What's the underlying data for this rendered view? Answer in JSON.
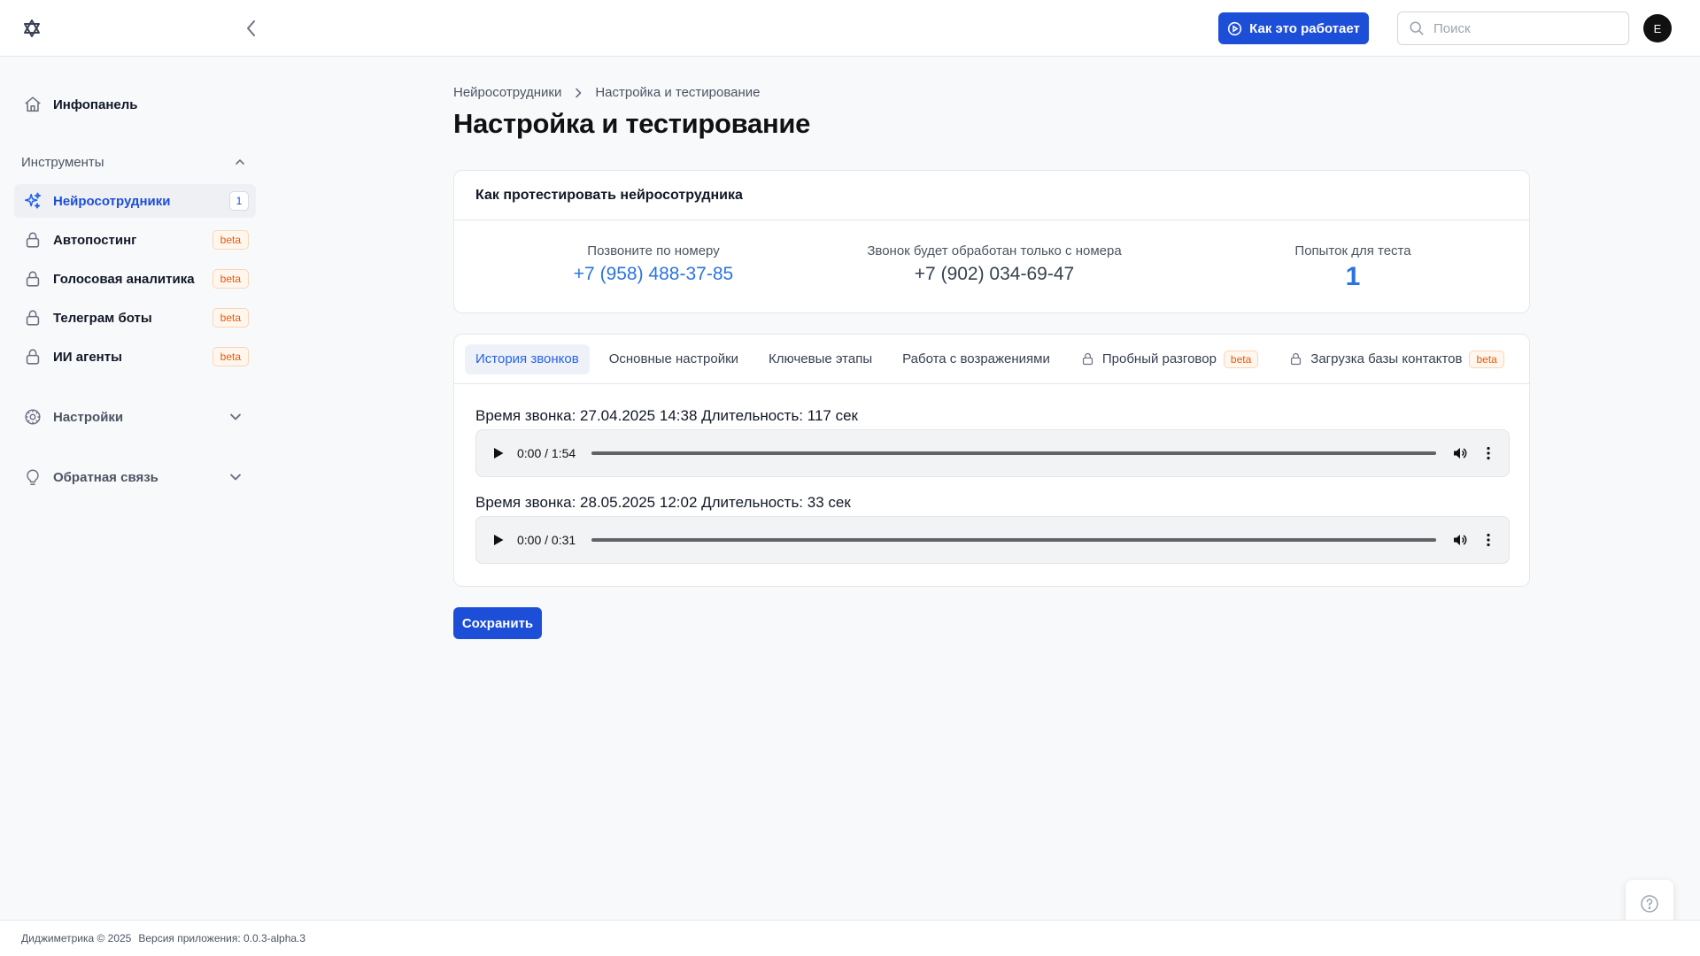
{
  "header": {
    "how_it_works_label": "Как это работает",
    "search_placeholder": "Поиск",
    "avatar_initial": "E"
  },
  "sidebar": {
    "dashboard_label": "Инфопанель",
    "tools_section": "Инструменты",
    "items": [
      {
        "label": "Нейросотрудники",
        "badge": "1",
        "active": true
      },
      {
        "label": "Автопостинг",
        "badge": "beta"
      },
      {
        "label": "Голосовая аналитика",
        "badge": "beta"
      },
      {
        "label": "Телеграм боты",
        "badge": "beta"
      },
      {
        "label": "ИИ агенты",
        "badge": "beta"
      }
    ],
    "settings_label": "Настройки",
    "feedback_label": "Обратная связь"
  },
  "breadcrumb": {
    "parent": "Нейросотрудники",
    "current": "Настройка и тестирование"
  },
  "page_title": "Настройка и тестирование",
  "test_card": {
    "title": "Как протестировать нейросотрудника",
    "call_caption": "Позвоните по номеру",
    "call_number": "+7 (958) 488-37-85",
    "processed_caption": "Звонок будет обработан только с номера",
    "processed_number": "+7 (902) 034-69-47",
    "attempts_caption": "Попыток для теста",
    "attempts_value": "1"
  },
  "tabs": [
    {
      "label": "История звонков",
      "active": true
    },
    {
      "label": "Основные настройки"
    },
    {
      "label": "Ключевые этапы"
    },
    {
      "label": "Работа с возражениями"
    },
    {
      "label": "Пробный разговор",
      "badge": "beta",
      "locked": true
    },
    {
      "label": "Загрузка базы контактов",
      "badge": "beta",
      "locked": true
    }
  ],
  "calls": [
    {
      "info": "Время звонка: 27.04.2025 14:38 Длительность: 117 сек",
      "time": "0:00 / 1:54",
      "progress": 0
    },
    {
      "info": "Время звонка: 28.05.2025 12:02 Длительность: 33 сек",
      "time": "0:00 / 0:31",
      "progress": 0
    }
  ],
  "save_label": "Сохранить",
  "footer": {
    "copyright": "Диджиметрика © 2025",
    "version": "Версия приложения: 0.0.3-alpha.3"
  },
  "colors": {
    "accent": "#1d4ed8",
    "link": "#2b74e0",
    "beta": "#ea580c"
  }
}
